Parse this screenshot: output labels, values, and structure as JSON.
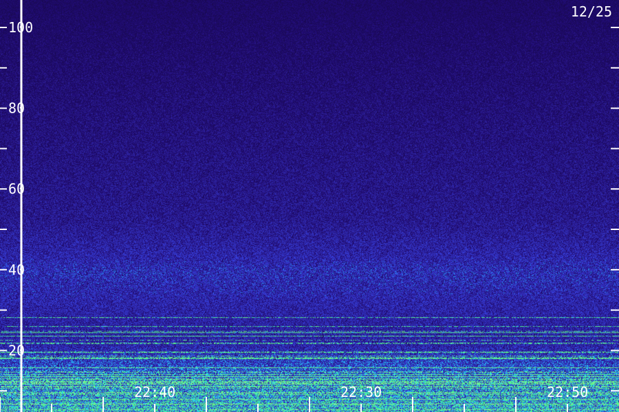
{
  "chart_data": {
    "type": "heatmap",
    "title": "",
    "date_label": "12/25",
    "xlabel": "",
    "ylabel": "",
    "x_range_minutes": [
      0,
      60
    ],
    "x_tick_minutes": [
      0,
      5,
      10,
      15,
      20,
      25,
      30,
      35,
      40,
      45,
      50,
      55
    ],
    "x_tick_labels": [
      {
        "minute": 15,
        "label": "22:40"
      },
      {
        "minute": 35,
        "label": "22:30"
      },
      {
        "minute": 55,
        "label": "22:50"
      }
    ],
    "y_range": [
      0,
      105
    ],
    "y_ticks": [
      10,
      20,
      30,
      40,
      50,
      60,
      70,
      80,
      90,
      100
    ],
    "y_tick_labels": [
      {
        "value": 20,
        "label": "20"
      },
      {
        "value": 40,
        "label": "40"
      },
      {
        "value": 60,
        "label": "60"
      },
      {
        "value": 80,
        "label": "80"
      },
      {
        "value": 100,
        "label": "100"
      }
    ],
    "colors": {
      "background": "#1c0a6e",
      "low": "#140640",
      "mid": "#3a20c8",
      "high": "#30e0ff",
      "peak": "#60ff80",
      "axis": "#ffffff"
    }
  }
}
